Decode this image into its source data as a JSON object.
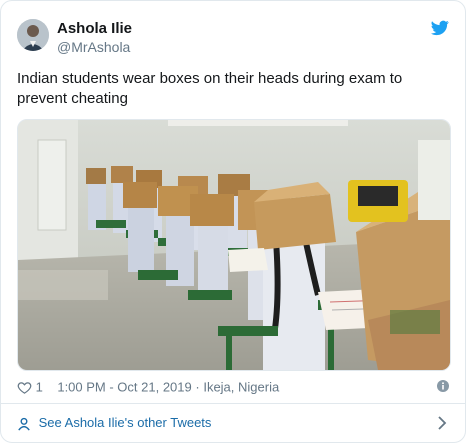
{
  "author": {
    "display_name": "Ashola Ilie",
    "handle": "@MrAshola",
    "avatar_icon": "user-avatar"
  },
  "brand": {
    "icon": "twitter-bird-icon",
    "color": "#1da1f2"
  },
  "tweet": {
    "text": "Indian students wear boxes on their heads during exam to prevent cheating",
    "media_icon": "classroom-photo"
  },
  "meta": {
    "like_count": "1",
    "timestamp": "1:00 PM - Oct 21, 2019",
    "separator": " · ",
    "location": "Ikeja, Nigeria"
  },
  "footer": {
    "link_label": "See Ashola Ilie's other Tweets",
    "link_color": "#1b6ca8"
  }
}
